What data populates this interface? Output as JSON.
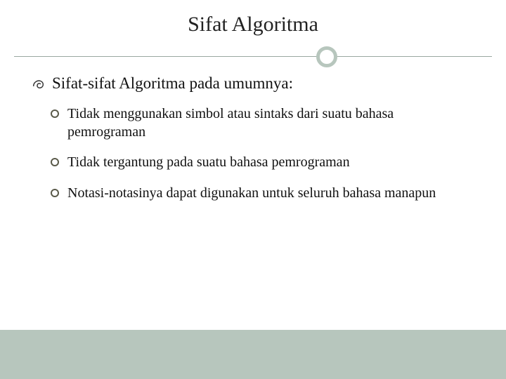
{
  "title": "Sifat Algoritma",
  "heading": "Sifat-sifat Algoritma pada umumnya:",
  "bullets": [
    "Tidak menggunakan simbol atau sintaks dari suatu bahasa pemrograman",
    "Tidak tergantung pada suatu bahasa pemrograman",
    "Notasi-notasinya dapat digunakan untuk seluruh bahasa manapun"
  ],
  "colors": {
    "accent": "#b7c6bd",
    "divider": "#9aa8a0",
    "bullet_ring": "#5a5a4a"
  }
}
